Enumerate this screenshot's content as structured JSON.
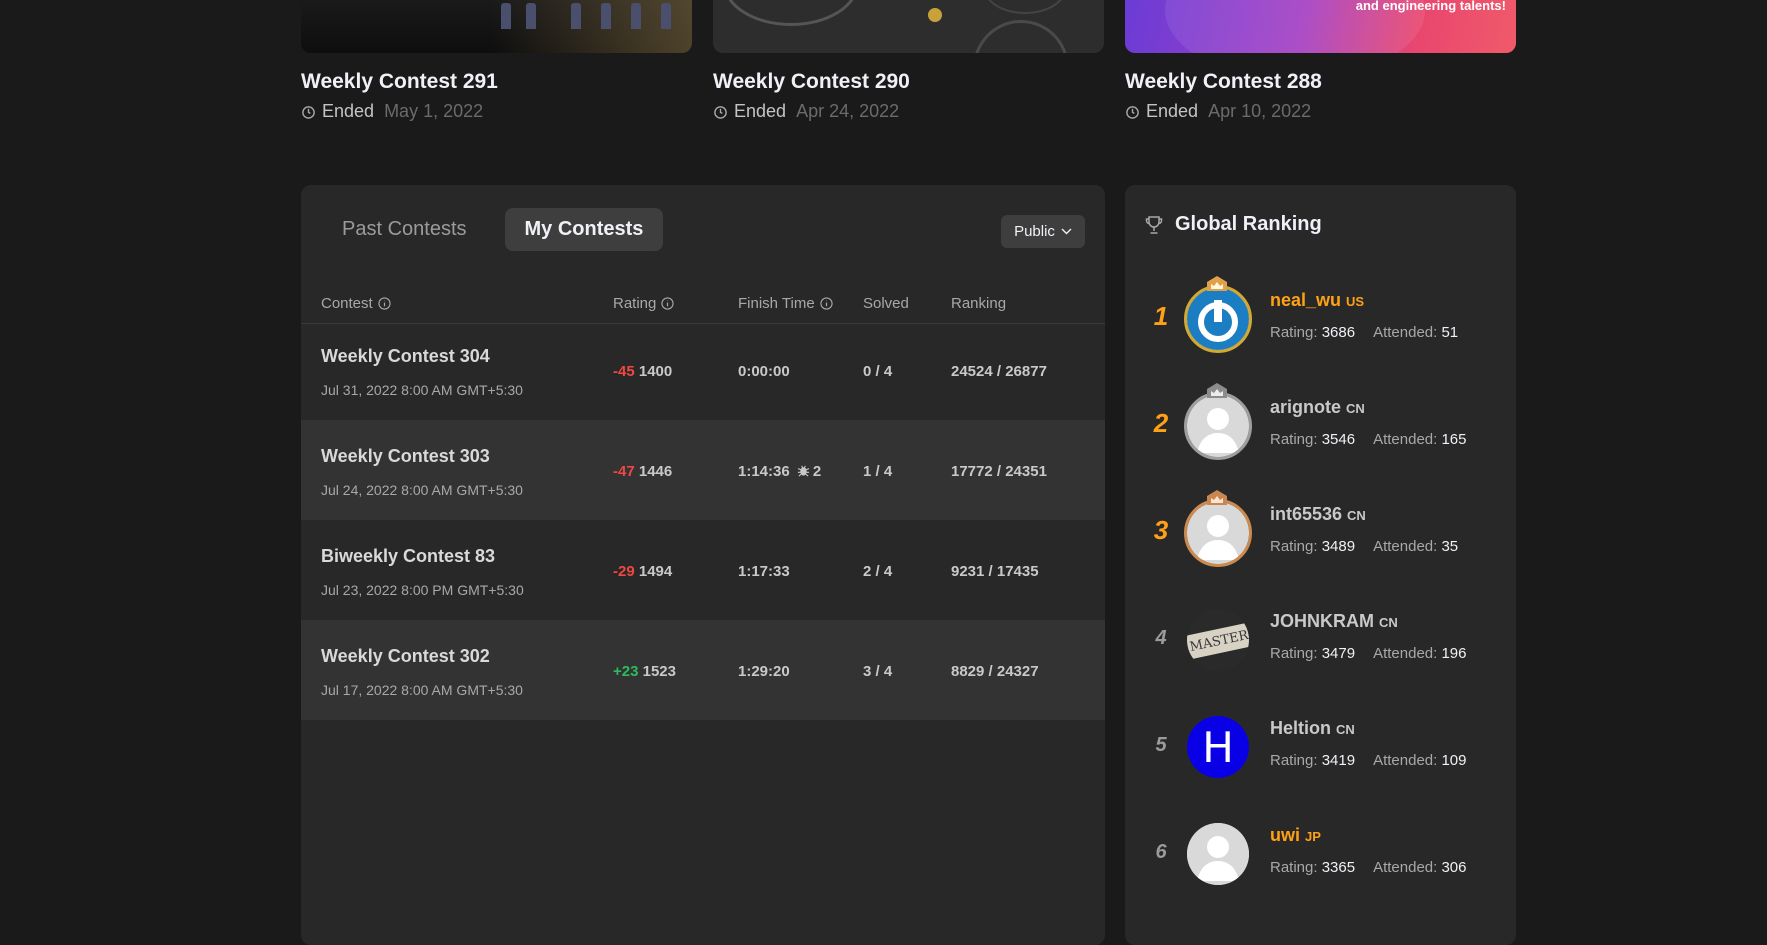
{
  "cards": [
    {
      "title": "Weekly Contest 291",
      "status": "Ended",
      "date": "May 1, 2022"
    },
    {
      "title": "Weekly Contest 290",
      "status": "Ended",
      "date": "Apr 24, 2022"
    },
    {
      "title": "Weekly Contest 288",
      "status": "Ended",
      "date": "Apr 10, 2022",
      "banner_text": "and engineering talents!"
    }
  ],
  "tabs": {
    "past": "Past Contests",
    "mine": "My Contests"
  },
  "visibility_select": "Public",
  "table": {
    "headers": {
      "contest": "Contest",
      "rating": "Rating",
      "finish_time": "Finish Time",
      "solved": "Solved",
      "ranking": "Ranking"
    },
    "rows": [
      {
        "name": "Weekly Contest 304",
        "date": "Jul 31, 2022 8:00 AM GMT+5:30",
        "delta": "-45",
        "rating": "1400",
        "finish": "0:00:00",
        "bugs": "",
        "solved": "0 / 4",
        "ranking": "24524 / 26877"
      },
      {
        "name": "Weekly Contest 303",
        "date": "Jul 24, 2022 8:00 AM GMT+5:30",
        "delta": "-47",
        "rating": "1446",
        "finish": "1:14:36",
        "bugs": "2",
        "solved": "1 / 4",
        "ranking": "17772 / 24351"
      },
      {
        "name": "Biweekly Contest 83",
        "date": "Jul 23, 2022 8:00 PM GMT+5:30",
        "delta": "-29",
        "rating": "1494",
        "finish": "1:17:33",
        "bugs": "",
        "solved": "2 / 4",
        "ranking": "9231 / 17435"
      },
      {
        "name": "Weekly Contest 302",
        "date": "Jul 17, 2022 8:00 AM GMT+5:30",
        "delta": "+23",
        "rating": "1523",
        "finish": "1:29:20",
        "bugs": "",
        "solved": "3 / 4",
        "ranking": "8829 / 24327"
      }
    ]
  },
  "global_ranking": {
    "title": "Global Ranking",
    "rating_label": "Rating:",
    "attended_label": "Attended:",
    "users": [
      {
        "rank": "1",
        "name": "neal_wu",
        "country": "US",
        "rating": "3686",
        "attended": "51",
        "name_color": "#ffa116"
      },
      {
        "rank": "2",
        "name": "arignote",
        "country": "CN",
        "rating": "3546",
        "attended": "165",
        "name_color": "#c9c9c9"
      },
      {
        "rank": "3",
        "name": "int65536",
        "country": "CN",
        "rating": "3489",
        "attended": "35",
        "name_color": "#c9c9c9"
      },
      {
        "rank": "4",
        "name": "JOHNKRAM",
        "country": "CN",
        "rating": "3479",
        "attended": "196",
        "name_color": "#c9c9c9",
        "avatar_text": "MASTER"
      },
      {
        "rank": "5",
        "name": "Heltion",
        "country": "CN",
        "rating": "3419",
        "attended": "109",
        "name_color": "#c9c9c9",
        "avatar_text": "H"
      },
      {
        "rank": "6",
        "name": "uwi",
        "country": "JP",
        "rating": "3365",
        "attended": "306",
        "name_color": "#ffa116"
      }
    ]
  }
}
